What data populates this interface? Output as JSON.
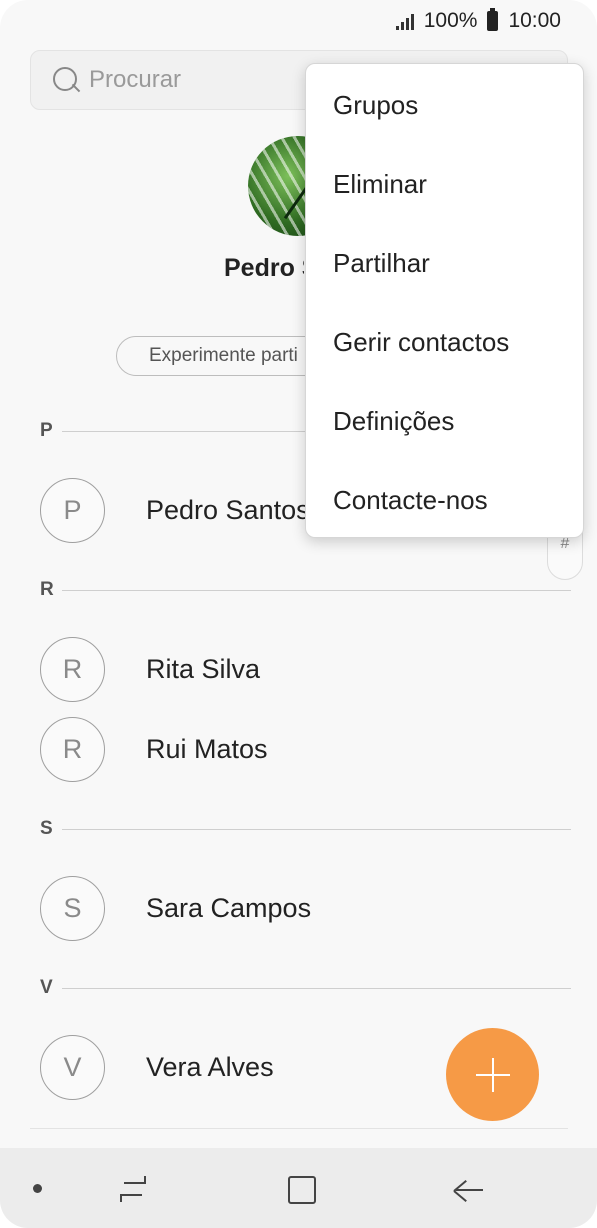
{
  "status_bar": {
    "battery": "100%",
    "time": "10:00"
  },
  "search": {
    "placeholder": "Procurar"
  },
  "profile": {
    "name": "Pedro S",
    "try_label": "Experimente parti"
  },
  "index_bar": {
    "last": "#"
  },
  "sections": [
    {
      "letter": "P",
      "contacts": [
        {
          "initial": "P",
          "name": "Pedro Santos"
        }
      ]
    },
    {
      "letter": "R",
      "contacts": [
        {
          "initial": "R",
          "name": "Rita Silva"
        },
        {
          "initial": "R",
          "name": "Rui Matos"
        }
      ]
    },
    {
      "letter": "S",
      "contacts": [
        {
          "initial": "S",
          "name": "Sara Campos"
        }
      ]
    },
    {
      "letter": "V",
      "contacts": [
        {
          "initial": "V",
          "name": "Vera Alves"
        }
      ]
    }
  ],
  "menu": {
    "items": [
      "Grupos",
      "Eliminar",
      "Partilhar",
      "Gerir contactos",
      "Definições",
      "Contacte-nos"
    ]
  },
  "colors": {
    "fab": "#f69a46",
    "background": "#f8f8f8"
  },
  "icons": {
    "fab": "plus-icon",
    "search": "search-icon",
    "nav": [
      "recents-icon",
      "home-icon",
      "back-icon"
    ]
  }
}
